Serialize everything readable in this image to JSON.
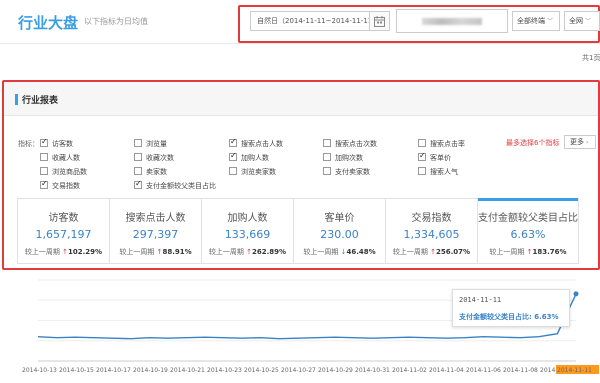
{
  "header": {
    "title": "行业大盘",
    "subtitle": "以下指标为日均值"
  },
  "filters": {
    "date_range": "自然日（2014-11-11~2014-11-11）",
    "terminal_select": "全部终端",
    "network_select": "全网",
    "pager_text": "共1页"
  },
  "report": {
    "title": "行业报表",
    "indicator_label": "指标：",
    "limit_note": "最多选择6个指标",
    "more_label": "更多",
    "checkboxes": [
      {
        "label": "访客数",
        "checked": true
      },
      {
        "label": "浏览量",
        "checked": false
      },
      {
        "label": "搜索点击人数",
        "checked": true
      },
      {
        "label": "搜索点击次数",
        "checked": false
      },
      {
        "label": "搜索点击率",
        "checked": false
      },
      {
        "label": "收藏人数",
        "checked": false
      },
      {
        "label": "收藏次数",
        "checked": false
      },
      {
        "label": "加购人数",
        "checked": true
      },
      {
        "label": "加购次数",
        "checked": false
      },
      {
        "label": "客单价",
        "checked": true
      },
      {
        "label": "浏览商品数",
        "checked": false
      },
      {
        "label": "卖家数",
        "checked": false
      },
      {
        "label": "浏览卖家数",
        "checked": false
      },
      {
        "label": "支付卖家数",
        "checked": false
      },
      {
        "label": "搜索人气",
        "checked": false
      },
      {
        "label": "交易指数",
        "checked": true
      },
      {
        "label": "支付金额较父类目占比",
        "checked": true
      }
    ],
    "metrics": [
      {
        "name": "访客数",
        "value": "1,657,197",
        "compare_label": "较上一周期",
        "direction": "up",
        "change": "102.29%"
      },
      {
        "name": "搜索点击人数",
        "value": "297,397",
        "compare_label": "较上一周期",
        "direction": "up",
        "change": "88.91%"
      },
      {
        "name": "加购人数",
        "value": "133,669",
        "compare_label": "较上一周期",
        "direction": "up",
        "change": "262.89%"
      },
      {
        "name": "客单价",
        "value": "230.00",
        "compare_label": "较上一周期",
        "direction": "down",
        "change": "46.48%"
      },
      {
        "name": "交易指数",
        "value": "1,334,605",
        "compare_label": "较上一周期",
        "direction": "up",
        "change": "256.07%"
      },
      {
        "name": "支付金额较父类目占比",
        "value": "6.63%",
        "compare_label": "较上一周期",
        "direction": "up",
        "change": "183.76%",
        "selected": true
      }
    ]
  },
  "tooltip": {
    "date": "2014-11-11",
    "series_text": "支付金额较父类目占比: 6.63%"
  },
  "chart_data": {
    "type": "line",
    "x": [
      "2014-10-13",
      "2014-10-14",
      "2014-10-15",
      "2014-10-16",
      "2014-10-17",
      "2014-10-18",
      "2014-10-19",
      "2014-10-20",
      "2014-10-21",
      "2014-10-22",
      "2014-10-23",
      "2014-10-24",
      "2014-10-25",
      "2014-10-26",
      "2014-10-27",
      "2014-10-28",
      "2014-10-29",
      "2014-10-30",
      "2014-10-31",
      "2014-11-01",
      "2014-11-02",
      "2014-11-03",
      "2014-11-04",
      "2014-11-05",
      "2014-11-06",
      "2014-11-07",
      "2014-11-08",
      "2014-11-09",
      "2014-11-10",
      "2014-11-11"
    ],
    "tick_labels": [
      "2014-10-13",
      "2014-10-15",
      "2014-10-17",
      "2014-10-19",
      "2014-10-21",
      "2014-10-23",
      "2014-10-25",
      "2014-10-27",
      "2014-10-29",
      "2014-10-31",
      "2014-11-02",
      "2014-11-04",
      "2014-11-06",
      "2014-11-08",
      "2014-11-10",
      "2014-11-11"
    ],
    "series": [
      {
        "name": "支付金额较父类目占比",
        "values": [
          2.4,
          2.3,
          2.35,
          2.3,
          2.25,
          2.2,
          2.3,
          2.25,
          2.3,
          2.35,
          2.3,
          2.25,
          2.3,
          2.2,
          2.25,
          2.3,
          2.35,
          2.3,
          2.25,
          2.3,
          2.35,
          2.3,
          2.25,
          2.3,
          2.4,
          2.35,
          2.3,
          2.4,
          2.7,
          6.63
        ],
        "color": "#3a82c8"
      }
    ],
    "highlight_color": "#ff9a1f",
    "grid": true
  }
}
